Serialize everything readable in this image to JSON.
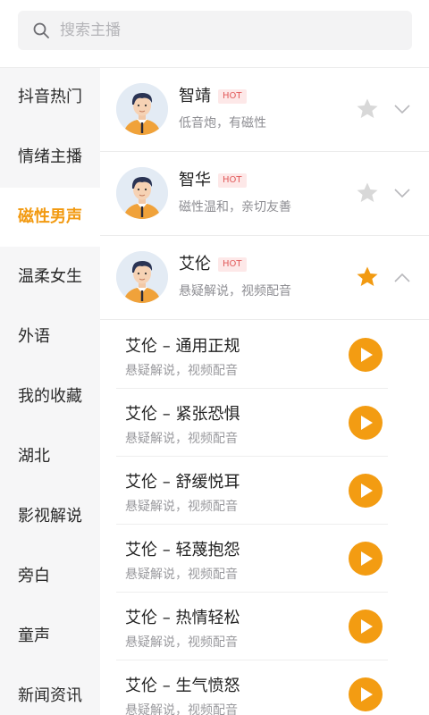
{
  "search": {
    "placeholder": "搜索主播",
    "icon": "search-icon"
  },
  "colors": {
    "accent": "#f29a11",
    "star_active": "#f29a11",
    "star_inactive": "#d8d8d8",
    "hot_bg": "#fde8e8",
    "hot_text": "#e25a5a",
    "play": "#f39c12"
  },
  "sidebar": {
    "active_index": 2,
    "items": [
      {
        "label": "抖音热门"
      },
      {
        "label": "情绪主播"
      },
      {
        "label": "磁性男声"
      },
      {
        "label": "温柔女生"
      },
      {
        "label": "外语"
      },
      {
        "label": "我的收藏"
      },
      {
        "label": "湖北"
      },
      {
        "label": "影视解说"
      },
      {
        "label": "旁白"
      },
      {
        "label": "童声"
      },
      {
        "label": "新闻资讯"
      }
    ]
  },
  "anchors": [
    {
      "name": "智靖",
      "badge": "HOT",
      "desc": "低音炮，有磁性",
      "favorited": false,
      "expanded": false
    },
    {
      "name": "智华",
      "badge": "HOT",
      "desc": "磁性温和，亲切友善",
      "favorited": false,
      "expanded": false
    },
    {
      "name": "艾伦",
      "badge": "HOT",
      "desc": "悬疑解说，视频配音",
      "favorited": true,
      "expanded": true
    }
  ],
  "styles": [
    {
      "title": "艾伦 – 通用正规",
      "desc": "悬疑解说，视频配音"
    },
    {
      "title": "艾伦 – 紧张恐惧",
      "desc": "悬疑解说，视频配音"
    },
    {
      "title": "艾伦 – 舒缓悦耳",
      "desc": "悬疑解说，视频配音"
    },
    {
      "title": "艾伦 – 轻蔑抱怨",
      "desc": "悬疑解说，视频配音"
    },
    {
      "title": "艾伦 – 热情轻松",
      "desc": "悬疑解说，视频配音"
    },
    {
      "title": "艾伦 – 生气愤怒",
      "desc": "悬疑解说，视频配音"
    }
  ]
}
